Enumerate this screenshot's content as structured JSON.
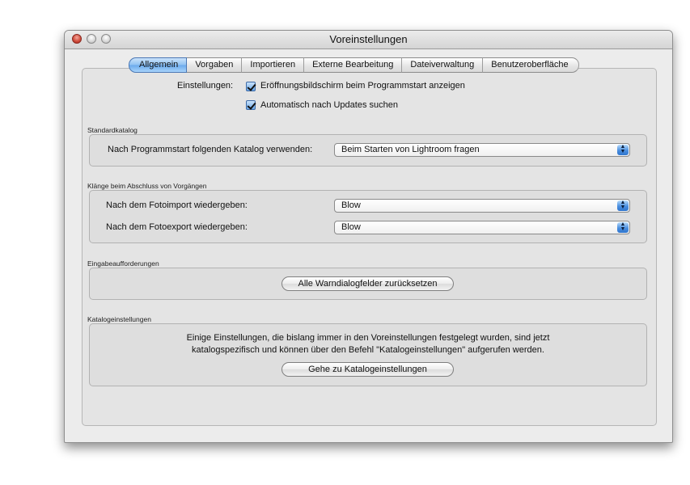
{
  "window": {
    "title": "Voreinstellungen"
  },
  "tabs": [
    {
      "label": "Allgemein",
      "active": true
    },
    {
      "label": "Vorgaben"
    },
    {
      "label": "Importieren"
    },
    {
      "label": "Externe Bearbeitung"
    },
    {
      "label": "Dateiverwaltung"
    },
    {
      "label": "Benutzeroberfläche"
    }
  ],
  "settings": {
    "label": "Einstellungen:",
    "checkbox1": {
      "label": "Eröffnungsbildschirm beim Programmstart anzeigen",
      "checked": true
    },
    "checkbox2": {
      "label": "Automatisch nach Updates suchen",
      "checked": true
    }
  },
  "standardkatalog": {
    "title": "Standardkatalog",
    "row_label": "Nach Programmstart folgenden Katalog verwenden:",
    "select_value": "Beim Starten von Lightroom fragen"
  },
  "sounds": {
    "title": "Klänge beim Abschluss von Vorgängen",
    "import_label": "Nach dem Fotoimport wiedergeben:",
    "import_value": "Blow",
    "export_label": "Nach dem Fotoexport wiedergeben:",
    "export_value": "Blow"
  },
  "prompts": {
    "title": "Eingabeaufforderungen",
    "reset_button": "Alle Warndialogfelder zurücksetzen"
  },
  "catalog_settings": {
    "title": "Katalogeinstellungen",
    "info_line1": "Einige Einstellungen, die bislang immer in den Voreinstellungen festgelegt wurden, sind jetzt",
    "info_line2": "katalogspezifisch und können über den Befehl \"Katalogeinstellungen\" aufgerufen werden.",
    "goto_button": "Gehe zu Katalogeinstellungen"
  },
  "icons": {
    "close": "close-button-icon",
    "minimize": "minimize-button-icon",
    "zoom": "zoom-button-icon",
    "popup": "updown-arrows-icon",
    "check": "checkmark-icon"
  }
}
